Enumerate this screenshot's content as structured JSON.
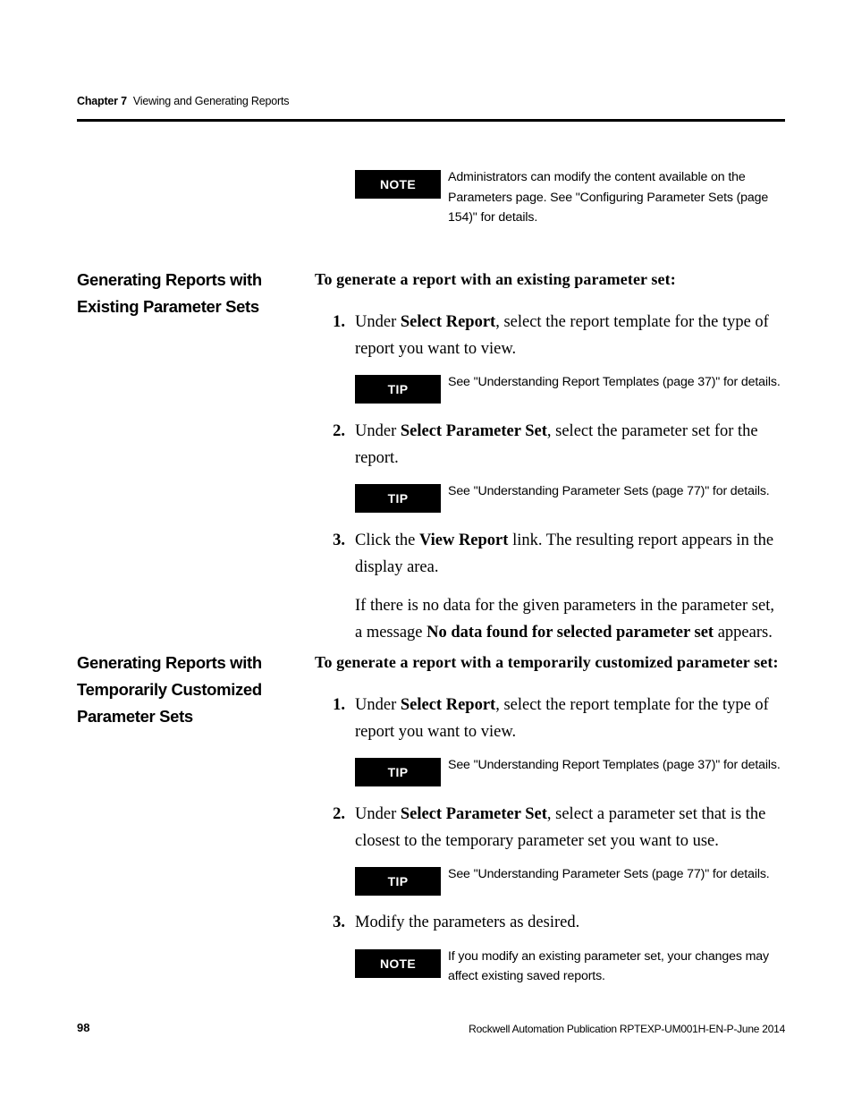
{
  "header": {
    "chapter": "Chapter 7",
    "title": "Viewing and Generating Reports"
  },
  "top_note": {
    "label": "NOTE",
    "text": "Administrators can modify the content available on the Parameters page. See \"Configuring Parameter Sets (page 154)\" for details."
  },
  "section_one": {
    "heading_line1": "Generating Reports with",
    "heading_line2": "Existing Parameter Sets",
    "lead": "To generate a report with an existing parameter set:",
    "step1_num": "1.",
    "step1_pre": "Under ",
    "step1_bold": "Select Report",
    "step1_post": ", select the report template for the type of report you want to view.",
    "tip1_label": "TIP",
    "tip1_text": "See \"Understanding Report Templates (page 37)\" for details.",
    "step2_num": "2.",
    "step2_pre": "Under ",
    "step2_bold": "Select Parameter Set",
    "step2_post": ", select the parameter set for the report.",
    "tip2_label": "TIP",
    "tip2_text": "See \"Understanding Parameter Sets (page 77)\" for details.",
    "step3_num": "3.",
    "step3_pre": "Click the ",
    "step3_bold": "View Report",
    "step3_post": " link. The resulting report appears in the display area.",
    "step3_extra_pre": "If there is no data for the given parameters in the parameter set, a message ",
    "step3_extra_bold": "No data found for selected parameter set",
    "step3_extra_post": " appears."
  },
  "section_two": {
    "heading_line1": "Generating Reports with",
    "heading_line2": "Temporarily Customized",
    "heading_line3": "Parameter Sets",
    "lead": "To generate a report with a temporarily customized parameter set:",
    "step1_num": "1.",
    "step1_pre": "Under ",
    "step1_bold": "Select Report",
    "step1_post": ", select the report template for the type of report you want to view.",
    "tip1_label": "TIP",
    "tip1_text": "See \"Understanding Report Templates (page 37)\" for details.",
    "step2_num": "2.",
    "step2_pre": "Under ",
    "step2_bold": "Select Parameter Set",
    "step2_post": ", select a parameter set that is the closest to the temporary parameter set you want to use.",
    "tip2_label": "TIP",
    "tip2_text": "See \"Understanding Parameter Sets (page 77)\" for details.",
    "step3_num": "3.",
    "step3_text": "Modify the parameters as desired.",
    "note_label": "NOTE",
    "note_text": "If you modify an existing parameter set, your changes may affect existing saved reports."
  },
  "footer": {
    "page_number": "98",
    "publication": "Rockwell Automation Publication RPTEXP-UM001H-EN-P-June 2014"
  }
}
